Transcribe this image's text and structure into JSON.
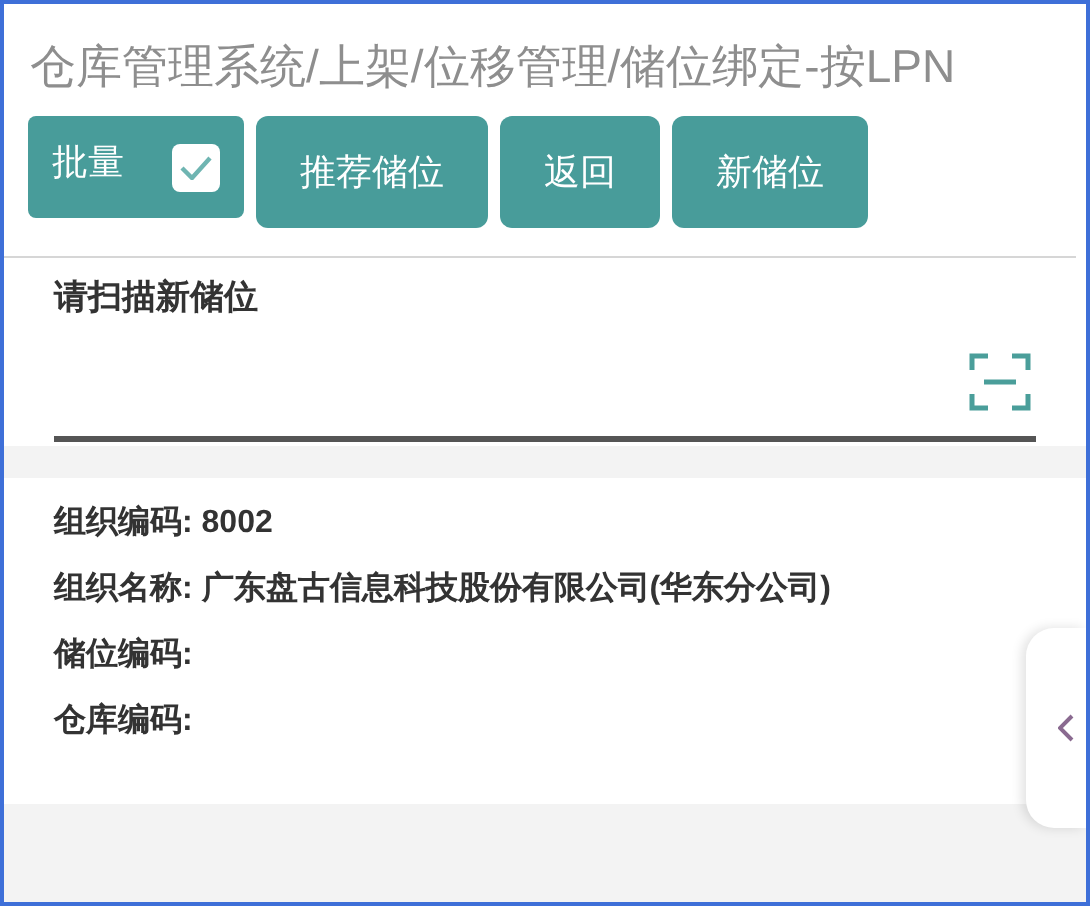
{
  "breadcrumb": "仓库管理系统/上架/位移管理/储位绑定-按LPN",
  "toolbar": {
    "batch": {
      "label": "批量",
      "checked": true
    },
    "buttons": [
      "推荐储位",
      "返回",
      "新储位"
    ]
  },
  "scan_field": {
    "label": "请扫描新储位"
  },
  "info": [
    {
      "label": "组织编码:",
      "value": "8002"
    },
    {
      "label": "组织名称:",
      "value": "广东盘古信息科技股份有限公司(华东分公司)"
    },
    {
      "label": "储位编码:"
    },
    {
      "label": "仓库编码:"
    }
  ]
}
